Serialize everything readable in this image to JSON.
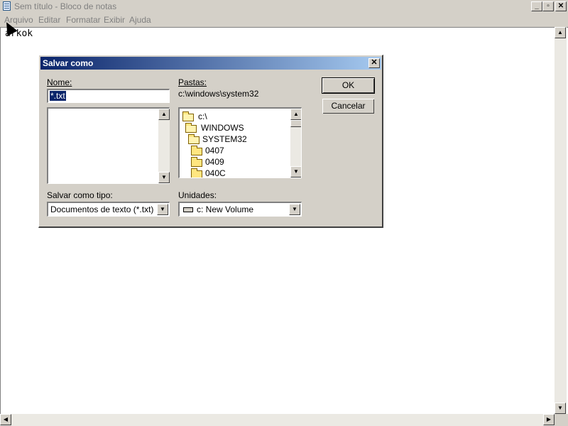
{
  "window": {
    "title": "Sem título - Bloco de notas",
    "minimize": "_",
    "maximize": "▫",
    "close": "✕"
  },
  "menu": [
    "Arquivo",
    "Editar",
    "Formatar",
    "Exibir",
    "Ajuda"
  ],
  "editor": {
    "text": "arkok"
  },
  "dialog": {
    "title": "Salvar como",
    "close": "✕",
    "name_label": "Nome:",
    "name_value": "*.txt",
    "folders_label": "Pastas:",
    "current_path": "c:\\windows\\system32",
    "folders": [
      "c:\\",
      "WINDOWS",
      "SYSTEM32",
      "0407",
      "0409",
      "040C"
    ],
    "type_label": "Salvar como tipo:",
    "type_value": "Documentos de texto (*.txt)",
    "drives_label": "Unidades:",
    "drives_value": "c: New Volume",
    "ok_label": "OK",
    "cancel_label": "Cancelar"
  },
  "icons": {
    "scroll_up": "▲",
    "scroll_down": "▼",
    "scroll_left": "◀",
    "scroll_right": "▶",
    "combo_arrow": "▼"
  }
}
